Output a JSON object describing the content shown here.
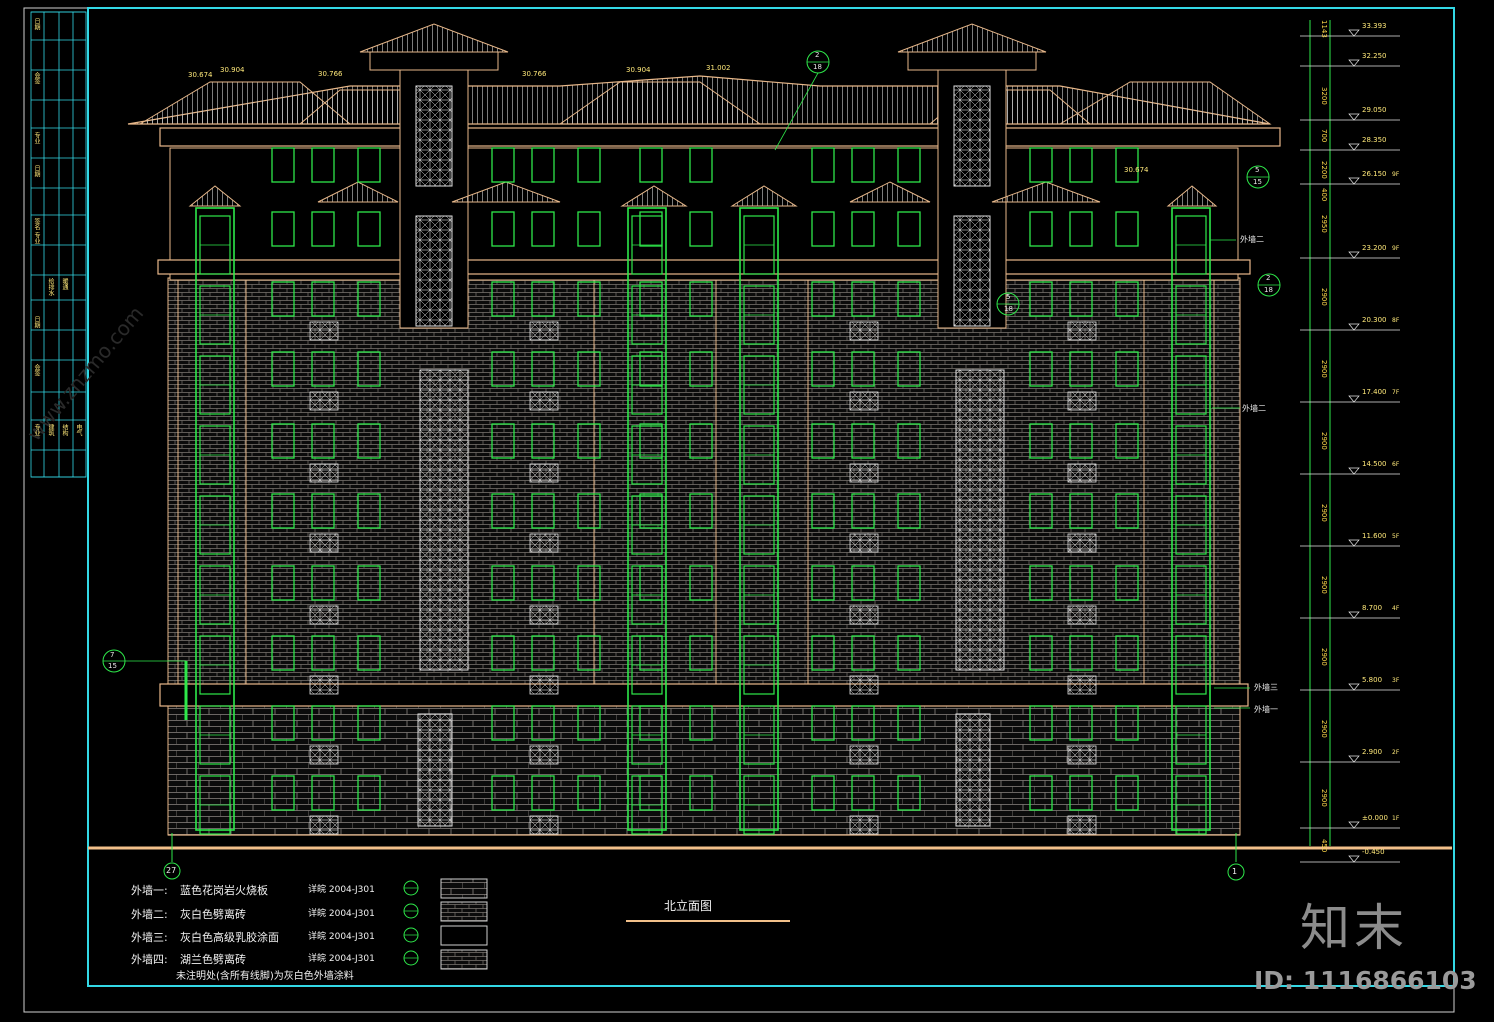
{
  "drawing": {
    "title": "北立面图",
    "id_label": "ID: 1116866103",
    "brand_logo": "知末",
    "watermark": "www.znzmo.com"
  },
  "levels": [
    {
      "elev": "33.393",
      "floor": ""
    },
    {
      "elev": "32.250",
      "floor": ""
    },
    {
      "elev": "29.050",
      "floor": ""
    },
    {
      "elev": "28.350",
      "floor": ""
    },
    {
      "elev": "26.150",
      "floor": "9F"
    },
    {
      "elev": "23.200",
      "floor": "9F"
    },
    {
      "elev": "20.300",
      "floor": "8F"
    },
    {
      "elev": "17.400",
      "floor": "7F"
    },
    {
      "elev": "14.500",
      "floor": "6F"
    },
    {
      "elev": "11.600",
      "floor": "5F"
    },
    {
      "elev": "8.700",
      "floor": "4F"
    },
    {
      "elev": "5.800",
      "floor": "3F"
    },
    {
      "elev": "2.900",
      "floor": "2F"
    },
    {
      "elev": "±0.000",
      "floor": "1F"
    },
    {
      "elev": "-0.450",
      "floor": ""
    }
  ],
  "dims": [
    "1143",
    "3200",
    "700",
    "2200",
    "400",
    "2950",
    "2900",
    "2900",
    "2900",
    "2900",
    "2900",
    "2900",
    "2900",
    "2900",
    "450"
  ],
  "roof_elevs": [
    "30.674",
    "30.904",
    "30.766",
    "30.766",
    "30.904",
    "31.002",
    "30.674"
  ],
  "wall_callouts": [
    "外墙二",
    "外墙二",
    "外墙三",
    "外墙一"
  ],
  "detail_bubbles": [
    {
      "top": "2",
      "bottom": "18"
    },
    {
      "top": "5",
      "bottom": "15"
    },
    {
      "top": "2",
      "bottom": "18"
    },
    {
      "top": "5",
      "bottom": "18"
    },
    {
      "top": "7",
      "bottom": "15"
    }
  ],
  "axis_labels": {
    "left": "27",
    "right": "1"
  },
  "legend": [
    {
      "name": "外墙一:",
      "desc": "蓝色花岗岩火烧板",
      "ref": "详皖 2004-J301"
    },
    {
      "name": "外墙二:",
      "desc": "灰白色劈离砖",
      "ref": "详皖 2004-J301"
    },
    {
      "name": "外墙三:",
      "desc": "灰白色高级乳胶涂面",
      "ref": "详皖 2004-J301"
    },
    {
      "name": "外墙四:",
      "desc": "湖兰色劈离砖",
      "ref": "详皖 2004-J301"
    }
  ],
  "legend_note": "未注明处(含所有线脚)为灰白色外墙涂料",
  "titleblock": [
    "日期",
    "会签",
    "专业",
    "日期",
    "签名",
    "专业",
    "给排水",
    "暖通",
    "日期",
    "会签",
    "专业",
    "建筑",
    "结构",
    "电气"
  ],
  "colors": {
    "frame": "#33d9e6",
    "window": "#2ee84a",
    "wall": "#e8b88a",
    "brick": "#6e6a66",
    "ground": "#f2c08a",
    "text": "#ffe97a"
  }
}
